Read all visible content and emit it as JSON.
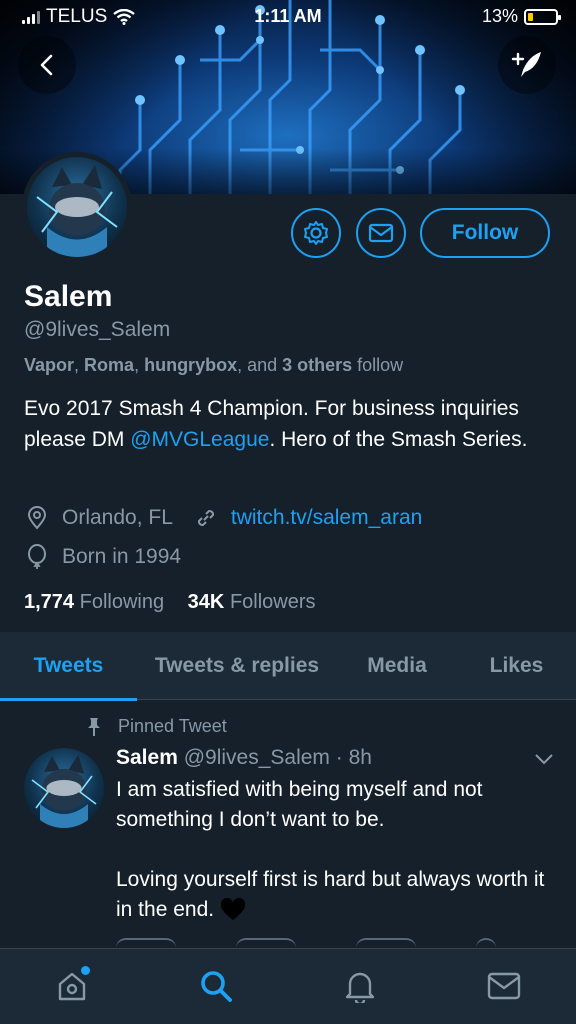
{
  "status_bar": {
    "carrier": "TELUS",
    "time": "1:11 AM",
    "battery": "13%"
  },
  "profile": {
    "display_name": "Salem",
    "handle": "@9lives_Salem",
    "followed_by": {
      "names": [
        "Vapor",
        "Roma",
        "hungrybox"
      ],
      "sep1": ", ",
      "sep2": ", ",
      "sep3": ", and ",
      "others": "3 others",
      "suffix": " follow"
    },
    "bio_parts": {
      "before": "Evo 2017 Smash 4 Champion. For business inquiries please DM ",
      "mention": "@MVGLeague",
      "after": ". Hero of the Smash Series."
    },
    "location": "Orlando, FL",
    "website": "twitch.tv/salem_aran",
    "born": "Born in 1994",
    "following_count": "1,774",
    "following_label": "Following",
    "followers_count": "34K",
    "followers_label": "Followers",
    "follow_button": "Follow"
  },
  "tabs": [
    {
      "label": "Tweets",
      "active": true
    },
    {
      "label": "Tweets & replies",
      "active": false
    },
    {
      "label": "Media",
      "active": false
    },
    {
      "label": "Likes",
      "active": false
    }
  ],
  "pinned_tweet": {
    "pinned_label": "Pinned Tweet",
    "author_name": "Salem",
    "author_handle": "@9lives_Salem",
    "time": "8h",
    "text": "I am satisfied with being myself and not something I don’t want to be.\n\nLoving yourself first is hard but always worth it in the end."
  },
  "colors": {
    "background": "#15202b",
    "accent": "#1da1f2",
    "secondary_text": "#8899a6",
    "bar_background": "#1c2a38"
  },
  "icons": {
    "back": "back-arrow-icon",
    "compose": "compose-tweet-icon",
    "settings": "gear-icon",
    "message": "envelope-icon",
    "location": "location-pin-icon",
    "link": "link-icon",
    "birthday": "balloon-icon",
    "pin": "pin-icon",
    "heart": "black-heart-emoji",
    "chevron": "chevron-down-icon",
    "nav": [
      "home-icon",
      "search-icon",
      "notifications-bell-icon",
      "messages-envelope-icon"
    ]
  }
}
